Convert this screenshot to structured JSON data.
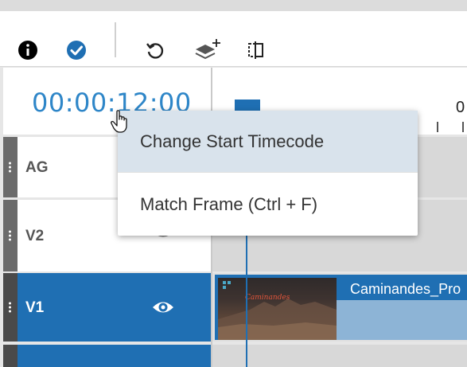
{
  "toolbar": {
    "icons": [
      "info-icon",
      "check-circle-icon",
      "refresh-icon",
      "add-layer-icon",
      "split-icon"
    ]
  },
  "timecode": {
    "value": "00:00:12:00"
  },
  "ruler": {
    "label": "0"
  },
  "tracks": [
    {
      "label": "AG"
    },
    {
      "label": "V2"
    },
    {
      "label": "V1"
    }
  ],
  "clip": {
    "name": "Caminandes_Pro",
    "thumb_text": "Caminandes"
  },
  "context_menu": {
    "items": [
      {
        "label": "Change Start Timecode"
      },
      {
        "label": "Match Frame (Ctrl + F)"
      }
    ]
  },
  "colors": {
    "accent": "#1f6fb3",
    "timecode": "#2e86c8",
    "selected_track": "#1f6fb3"
  }
}
